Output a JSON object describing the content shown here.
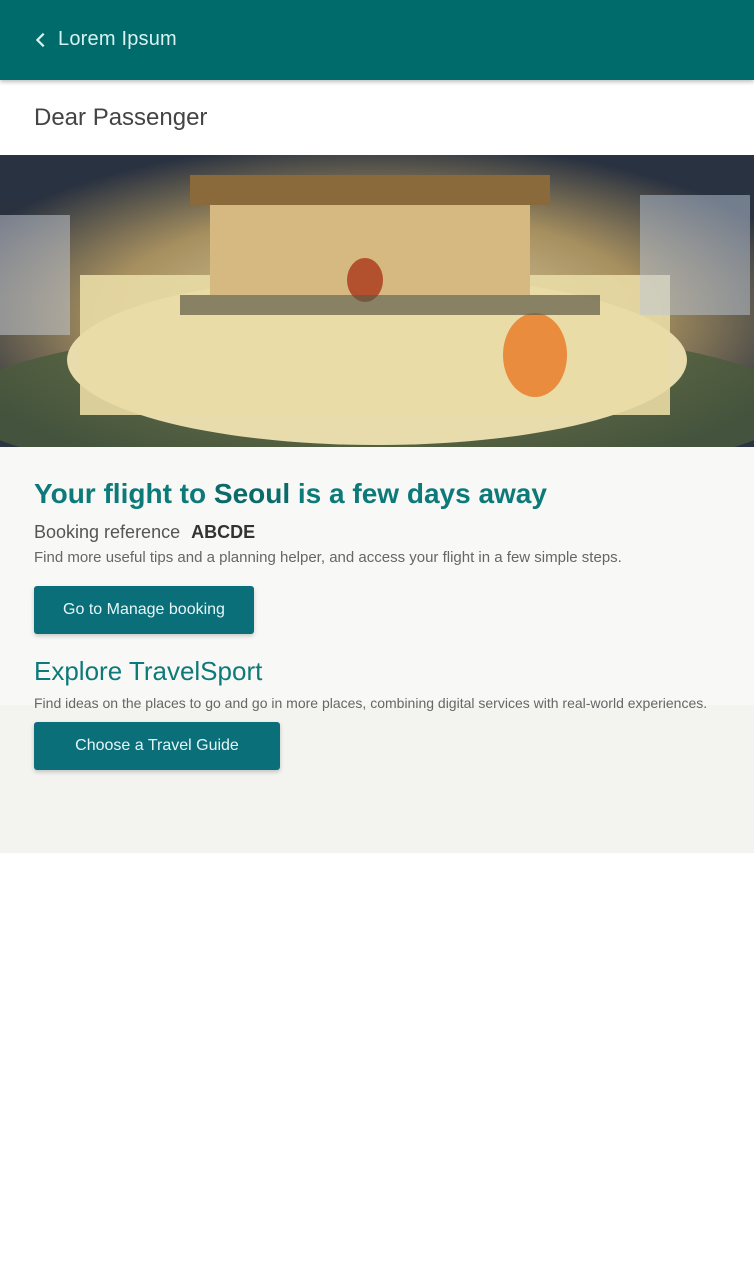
{
  "header": {
    "back_label": "Lorem Ipsum",
    "greeting": "Dear Passenger"
  },
  "trip": {
    "headline_prefix": "Your flight to",
    "destination": "Seoul",
    "headline_suffix": "is a few days away",
    "booking_label": "Booking reference",
    "booking_code": "ABCDE",
    "hint": "Find more useful tips and a planning helper, and access your flight in a few simple steps.",
    "manage_button": "Go to Manage booking"
  },
  "explore": {
    "title": "Explore TravelSport",
    "text": "Find ideas on the places to go and go in more places, combining digital services with real-world experiences.",
    "guide_button": "Choose a Travel Guide"
  },
  "colors": {
    "header": "#006b6b",
    "accent": "#0d7a7a",
    "button": "#0b6f7a"
  }
}
